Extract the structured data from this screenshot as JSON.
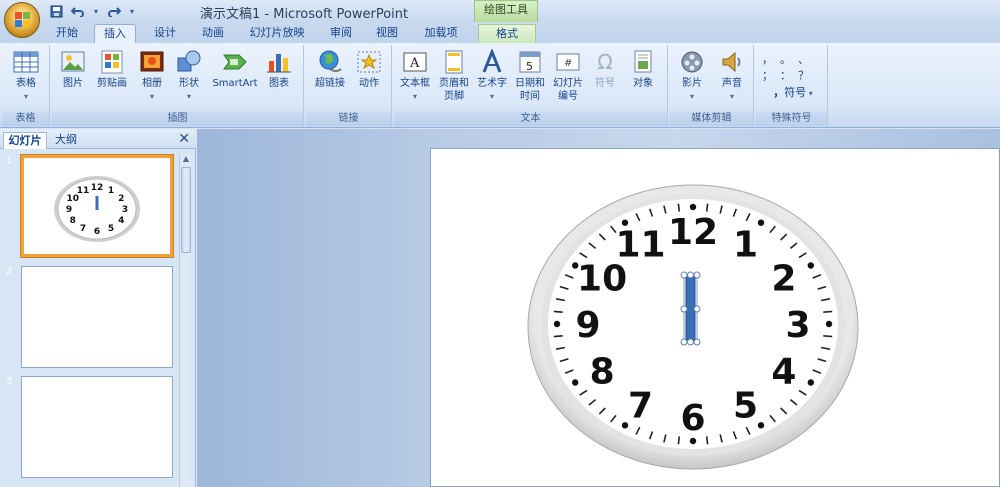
{
  "window": {
    "title": "演示文稿1 - Microsoft PowerPoint",
    "context_tab_title": "绘图工具"
  },
  "tabs": [
    {
      "label": "开始"
    },
    {
      "label": "插入",
      "active": true
    },
    {
      "label": "设计"
    },
    {
      "label": "动画"
    },
    {
      "label": "幻灯片放映"
    },
    {
      "label": "审阅"
    },
    {
      "label": "视图"
    },
    {
      "label": "加载项"
    },
    {
      "label": "格式",
      "context": true
    }
  ],
  "ribbon": {
    "groups": {
      "table": "表格",
      "illustrations": "插图",
      "links": "链接",
      "text": "文本",
      "media": "媒体剪辑",
      "symbols": "特殊符号"
    },
    "buttons": {
      "table": "表格",
      "picture": "图片",
      "clipart": "剪贴画",
      "album": "相册",
      "shapes": "形状",
      "smartart": "SmartArt",
      "chart": "图表",
      "hyperlink": "超链接",
      "action": "动作",
      "textbox": "文本框",
      "header_footer_1": "页眉和",
      "header_footer_2": "页脚",
      "wordart": "艺术字",
      "datetime_1": "日期和",
      "datetime_2": "时间",
      "slide_number_1": "幻灯片",
      "slide_number_2": "编号",
      "symbol": "符号",
      "object": "对象",
      "movie": "影片",
      "sound": "声音",
      "special_symbol": "符号",
      "punct_row1": "，  。  、",
      "punct_row2": "；  ：  ？"
    }
  },
  "panel": {
    "tab_slides": "幻灯片",
    "tab_outline": "大纲",
    "slide_numbers": [
      "1",
      "2",
      "3"
    ]
  },
  "clock": {
    "numbers": [
      "12",
      "1",
      "2",
      "3",
      "4",
      "5",
      "6",
      "7",
      "8",
      "9",
      "10",
      "11"
    ]
  },
  "colors": {
    "ribbon_bg": "#dbe8f8",
    "selected_thumb_border": "#f0a33c",
    "hand_color": "#3a6fb5"
  }
}
